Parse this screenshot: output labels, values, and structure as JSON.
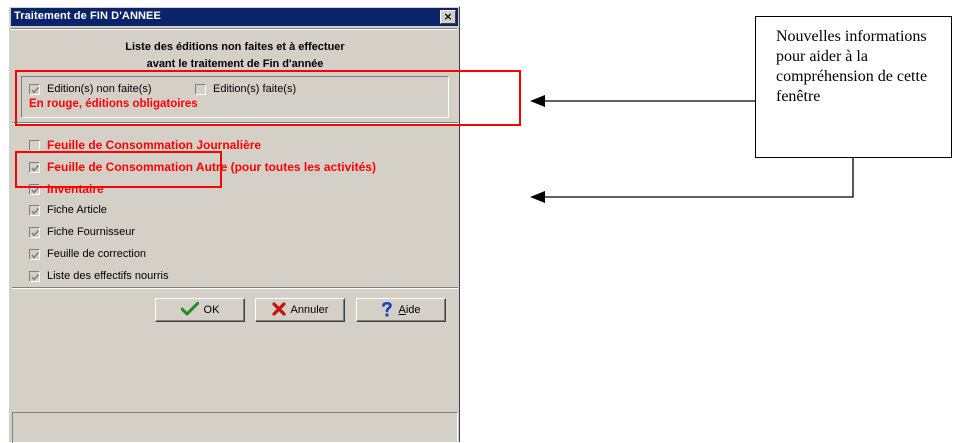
{
  "dialog": {
    "title": "Traitement de FIN D'ANNEE",
    "close_glyph": "×",
    "heading_line1": "Liste des éditions non faites et à effectuer",
    "heading_line2": "avant le traitement de Fin d'année"
  },
  "filters": {
    "non_faites": {
      "label": "Edition(s) non faite(s)",
      "checked": true
    },
    "faites": {
      "label": "Edition(s) faite(s)",
      "checked": false
    },
    "note": "En rouge, éditions obligatoires"
  },
  "editions": [
    {
      "label": "Feuille de Consommation Journalière",
      "checked": false,
      "required": true
    },
    {
      "label": "Feuille de Consommation Autre (pour toutes les activités)",
      "checked": true,
      "required": true
    },
    {
      "label": "Inventaire",
      "checked": true,
      "required": true
    },
    {
      "label": "Fiche Article",
      "checked": true,
      "required": false
    },
    {
      "label": "Fiche Fournisseur",
      "checked": true,
      "required": false
    },
    {
      "label": "Feuille de correction",
      "checked": true,
      "required": false
    },
    {
      "label": "Liste des effectifs nourris",
      "checked": true,
      "required": false
    }
  ],
  "buttons": {
    "ok": "OK",
    "annuler": "Annuler",
    "aide": "Aide",
    "aide_mnemonic": "A"
  },
  "annotation": {
    "text": "Nouvelles informations pour aider à la compréhension de cette fenêtre"
  },
  "colors": {
    "title_bg": "#0a246a",
    "dialog_bg": "#d4d0c8",
    "required_text": "#ff0000",
    "highlight": "#ff0000",
    "ok_check": "#1f8a1f",
    "annuler_x": "#c0140c",
    "aide_q": "#1a3fbf"
  },
  "icons": {
    "ok": "checkmark-icon",
    "annuler": "x-icon",
    "aide": "question-icon",
    "close": "close-icon"
  }
}
